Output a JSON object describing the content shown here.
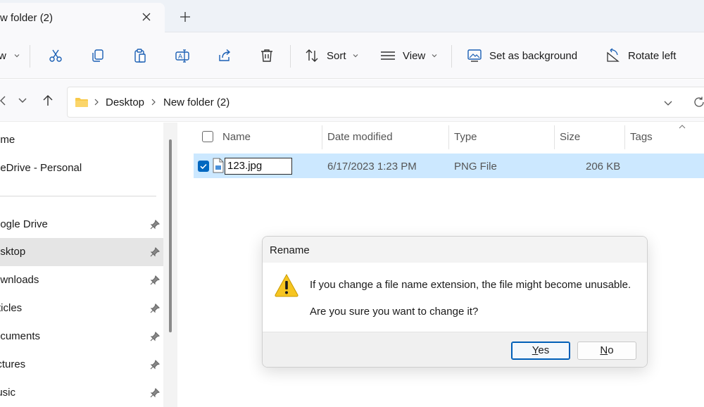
{
  "tab": {
    "title": "w folder (2)"
  },
  "toolbar": {
    "new_label": "w",
    "sort_label": "Sort",
    "view_label": "View",
    "set_background_label": "Set as background",
    "rotate_left_label": "Rotate left"
  },
  "address": {
    "crumbs": [
      "Desktop",
      "New folder (2)"
    ]
  },
  "sidebar": {
    "items": [
      {
        "label": "ome",
        "pinned": false,
        "selected": false
      },
      {
        "label": "neDrive - Personal",
        "pinned": false,
        "selected": false
      },
      {
        "label": "oogle Drive",
        "pinned": true,
        "selected": false
      },
      {
        "label": "esktop",
        "pinned": true,
        "selected": true
      },
      {
        "label": "ownloads",
        "pinned": true,
        "selected": false
      },
      {
        "label": "rticles",
        "pinned": true,
        "selected": false
      },
      {
        "label": "ocuments",
        "pinned": true,
        "selected": false
      },
      {
        "label": "ictures",
        "pinned": true,
        "selected": false
      },
      {
        "label": "lusic",
        "pinned": true,
        "selected": false
      }
    ]
  },
  "columns": {
    "name": "Name",
    "date_modified": "Date modified",
    "type": "Type",
    "size": "Size",
    "tags": "Tags"
  },
  "files": [
    {
      "name": "123.jpg",
      "date_modified": "6/17/2023 1:23 PM",
      "type": "PNG File",
      "size": "206 KB",
      "selected": true
    }
  ],
  "dialog": {
    "title": "Rename",
    "message": "If you change a file name extension, the file might become unusable.",
    "question": "Are you sure you want to change it?",
    "yes_label": "Yes",
    "no_label": "No"
  },
  "colors": {
    "selection": "#cce8ff",
    "accent": "#0067c0",
    "sidebar_selected": "#e5e5e5",
    "warning": "#f6c521"
  }
}
